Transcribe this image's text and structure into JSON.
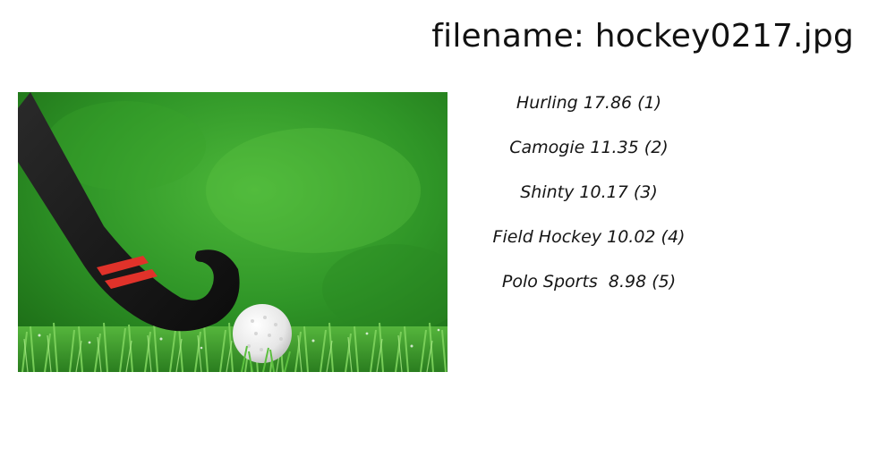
{
  "header": {
    "filename_label": "filename: hockey0217.jpg"
  },
  "image": {
    "subject_icon": "field-hockey-stick-and-ball",
    "colors": {
      "grass": "#2e8b24",
      "stick": "#141414",
      "stripe": "#e0322a",
      "ball": "#efefef"
    }
  },
  "predictions": [
    {
      "text": "Hurling 17.86 (1)"
    },
    {
      "text": "Camogie 11.35 (2)"
    },
    {
      "text": "Shinty 10.17 (3)"
    },
    {
      "text": "Field Hockey 10.02 (4)"
    },
    {
      "text": "Polo Sports  8.98 (5)"
    }
  ]
}
